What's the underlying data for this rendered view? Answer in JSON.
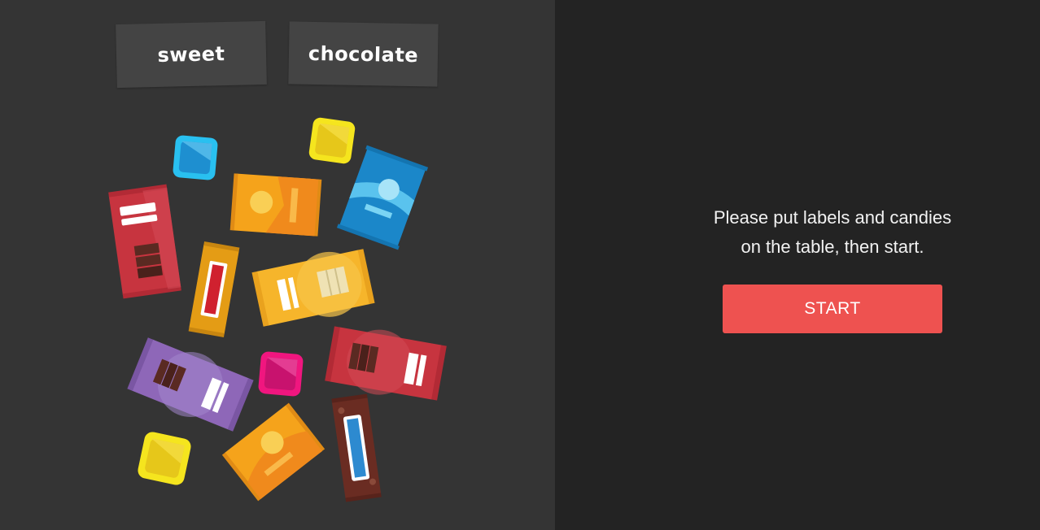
{
  "labels": {
    "sweet": "sweet",
    "chocolate": "chocolate"
  },
  "instructions": {
    "line1": "Please put labels and candies",
    "line2": "on the table, then start."
  },
  "start_button": "START",
  "colors": {
    "table_bg": "#343434",
    "panel_bg": "#232323",
    "label_bg": "#444444",
    "start_button": "#ee5250"
  },
  "candies": [
    "blue-square-candy",
    "yellow-square-candy",
    "red-chocolate-bar",
    "orange-candy-bar",
    "blue-candy-pouch",
    "red-stick-candy",
    "yellow-wrapped-bar",
    "red-wrapped-chocolate",
    "purple-wrapped-chocolate",
    "pink-square-candy",
    "yellow-square-candy-2",
    "orange-candy-pouch",
    "brown-stick-candy"
  ]
}
